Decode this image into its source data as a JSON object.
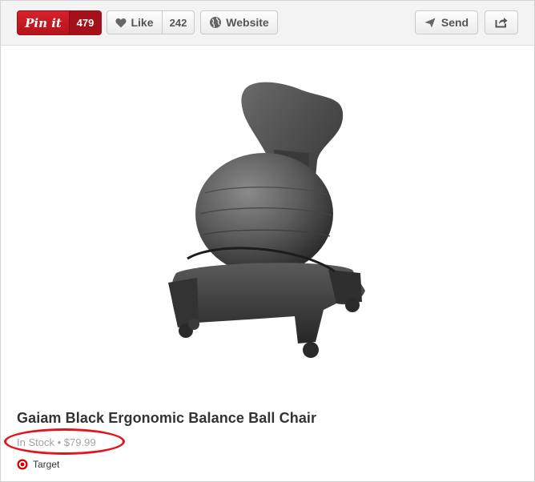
{
  "toolbar": {
    "pin_label": "Pin it",
    "pin_count": "479",
    "like_label": "Like",
    "like_count": "242",
    "website_label": "Website",
    "send_label": "Send"
  },
  "product": {
    "title": "Gaiam Black Ergonomic Balance Ball Chair",
    "availability": "In Stock",
    "separator": "•",
    "price": "$79.99",
    "store": "Target"
  },
  "colors": {
    "pin_red": "#cb2027",
    "annotation_red": "#e3151c",
    "target_red": "#cc0000"
  },
  "icons": [
    "heart-icon",
    "globe-icon",
    "send-icon",
    "share-icon",
    "target-logo-icon"
  ]
}
